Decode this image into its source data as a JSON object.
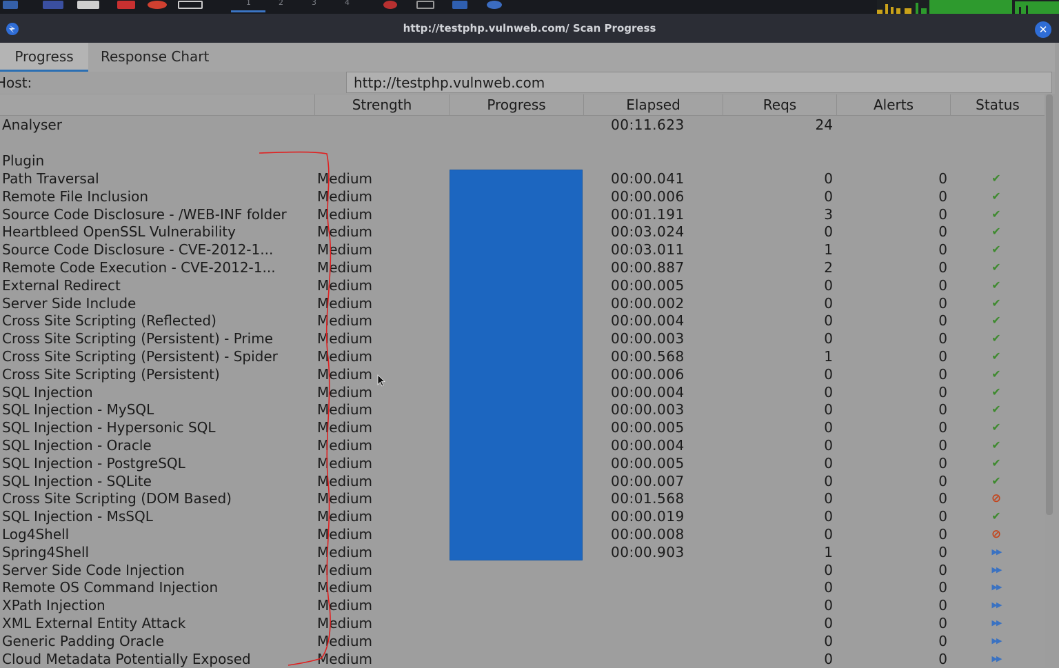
{
  "window": {
    "title": "http://testphp.vulnweb.com/ Scan Progress"
  },
  "tabs": [
    "Progress",
    "Response Chart"
  ],
  "host": {
    "label": "Host:",
    "value": "http://testphp.vulnweb.com"
  },
  "columns": [
    "Strength",
    "Progress",
    "Elapsed",
    "Reqs",
    "Alerts",
    "Status"
  ],
  "analyser": {
    "label": "Analyser",
    "elapsed": "00:11.623",
    "reqs": "24"
  },
  "plugin_section": "Plugin",
  "plugins": [
    {
      "name": "Path Traversal",
      "strength": "Medium",
      "elapsed": "00:00.041",
      "reqs": "0",
      "alerts": "0",
      "status": "done"
    },
    {
      "name": "Remote File Inclusion",
      "strength": "Medium",
      "elapsed": "00:00.006",
      "reqs": "0",
      "alerts": "0",
      "status": "done"
    },
    {
      "name": "Source Code Disclosure - /WEB-INF folder",
      "strength": "Medium",
      "elapsed": "00:01.191",
      "reqs": "3",
      "alerts": "0",
      "status": "done"
    },
    {
      "name": "Heartbleed OpenSSL Vulnerability",
      "strength": "Medium",
      "elapsed": "00:03.024",
      "reqs": "0",
      "alerts": "0",
      "status": "done"
    },
    {
      "name": "Source Code Disclosure - CVE-2012-1...",
      "strength": "Medium",
      "elapsed": "00:03.011",
      "reqs": "1",
      "alerts": "0",
      "status": "done"
    },
    {
      "name": "Remote Code Execution - CVE-2012-1...",
      "strength": "Medium",
      "elapsed": "00:00.887",
      "reqs": "2",
      "alerts": "0",
      "status": "done"
    },
    {
      "name": "External Redirect",
      "strength": "Medium",
      "elapsed": "00:00.005",
      "reqs": "0",
      "alerts": "0",
      "status": "done"
    },
    {
      "name": "Server Side Include",
      "strength": "Medium",
      "elapsed": "00:00.002",
      "reqs": "0",
      "alerts": "0",
      "status": "done"
    },
    {
      "name": "Cross Site Scripting (Reflected)",
      "strength": "Medium",
      "elapsed": "00:00.004",
      "reqs": "0",
      "alerts": "0",
      "status": "done"
    },
    {
      "name": "Cross Site Scripting (Persistent) - Prime",
      "strength": "Medium",
      "elapsed": "00:00.003",
      "reqs": "0",
      "alerts": "0",
      "status": "done"
    },
    {
      "name": "Cross Site Scripting (Persistent) - Spider",
      "strength": "Medium",
      "elapsed": "00:00.568",
      "reqs": "1",
      "alerts": "0",
      "status": "done"
    },
    {
      "name": "Cross Site Scripting (Persistent)",
      "strength": "Medium",
      "elapsed": "00:00.006",
      "reqs": "0",
      "alerts": "0",
      "status": "done"
    },
    {
      "name": "SQL Injection",
      "strength": "Medium",
      "elapsed": "00:00.004",
      "reqs": "0",
      "alerts": "0",
      "status": "done"
    },
    {
      "name": "SQL Injection - MySQL",
      "strength": "Medium",
      "elapsed": "00:00.003",
      "reqs": "0",
      "alerts": "0",
      "status": "done"
    },
    {
      "name": "SQL Injection - Hypersonic SQL",
      "strength": "Medium",
      "elapsed": "00:00.005",
      "reqs": "0",
      "alerts": "0",
      "status": "done"
    },
    {
      "name": "SQL Injection - Oracle",
      "strength": "Medium",
      "elapsed": "00:00.004",
      "reqs": "0",
      "alerts": "0",
      "status": "done"
    },
    {
      "name": "SQL Injection - PostgreSQL",
      "strength": "Medium",
      "elapsed": "00:00.005",
      "reqs": "0",
      "alerts": "0",
      "status": "done"
    },
    {
      "name": "SQL Injection - SQLite",
      "strength": "Medium",
      "elapsed": "00:00.007",
      "reqs": "0",
      "alerts": "0",
      "status": "done"
    },
    {
      "name": "Cross Site Scripting (DOM Based)",
      "strength": "Medium",
      "elapsed": "00:01.568",
      "reqs": "0",
      "alerts": "0",
      "status": "stopped"
    },
    {
      "name": "SQL Injection - MsSQL",
      "strength": "Medium",
      "elapsed": "00:00.019",
      "reqs": "0",
      "alerts": "0",
      "status": "done"
    },
    {
      "name": "Log4Shell",
      "strength": "Medium",
      "elapsed": "00:00.008",
      "reqs": "0",
      "alerts": "0",
      "status": "stopped"
    },
    {
      "name": "Spring4Shell",
      "strength": "Medium",
      "elapsed": "00:00.903",
      "reqs": "1",
      "alerts": "0",
      "status": "queued"
    },
    {
      "name": "Server Side Code Injection",
      "strength": "Medium",
      "elapsed": "",
      "reqs": "0",
      "alerts": "0",
      "status": "queued"
    },
    {
      "name": "Remote OS Command Injection",
      "strength": "Medium",
      "elapsed": "",
      "reqs": "0",
      "alerts": "0",
      "status": "queued"
    },
    {
      "name": "XPath Injection",
      "strength": "Medium",
      "elapsed": "",
      "reqs": "0",
      "alerts": "0",
      "status": "queued"
    },
    {
      "name": "XML External Entity Attack",
      "strength": "Medium",
      "elapsed": "",
      "reqs": "0",
      "alerts": "0",
      "status": "queued"
    },
    {
      "name": "Generic Padding Oracle",
      "strength": "Medium",
      "elapsed": "",
      "reqs": "0",
      "alerts": "0",
      "status": "queued"
    },
    {
      "name": "Cloud Metadata Potentially Exposed",
      "strength": "Medium",
      "elapsed": "",
      "reqs": "0",
      "alerts": "0",
      "status": "queued"
    }
  ],
  "status_icons": {
    "done": "checkmark-icon",
    "stopped": "stop-icon",
    "queued": "fast-forward-icon"
  },
  "colors": {
    "progress_fill": "#1c66c0",
    "check": "#3d8a2d",
    "stop": "#c4451c",
    "queued": "#3a72c2",
    "annotation": "#e02020"
  },
  "workspaces": [
    "1",
    "2",
    "3",
    "4"
  ]
}
